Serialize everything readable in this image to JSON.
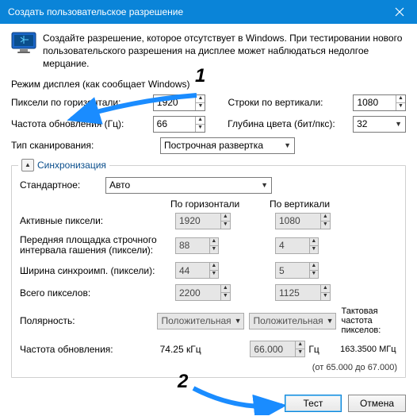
{
  "window": {
    "title": "Создать пользовательское разрешение"
  },
  "intro": "Создайте разрешение, которое отсутствует в Windows. При тестировании нового пользовательского разрешения на дисплее может наблюдаться недолгое мерцание.",
  "mode_label": "Режим дисплея (как сообщает Windows)",
  "fields": {
    "hpixels_label": "Пиксели по горизонтали:",
    "hpixels": "1920",
    "vlines_label": "Строки по вертикали:",
    "vlines": "1080",
    "refresh_label": "Частота обновления (Гц):",
    "refresh": "66",
    "depth_label": "Глубина цвета (бит/пкс):",
    "depth": "32",
    "scan_label": "Тип сканирования:",
    "scan": "Построчная развертка"
  },
  "sync": {
    "title": "Синхронизация",
    "standard_label": "Стандартное:",
    "standard": "Авто",
    "col_h": "По горизонтали",
    "col_v": "По вертикали",
    "active_label": "Активные пиксели:",
    "active_h": "1920",
    "active_v": "1080",
    "porch_label": "Передняя площадка строчного интервала гашения (пиксели):",
    "porch_h": "88",
    "porch_v": "4",
    "syncw_label": "Ширина синхроимп. (пиксели):",
    "syncw_h": "44",
    "syncw_v": "5",
    "total_label": "Всего пикселов:",
    "total_h": "2200",
    "total_v": "1125",
    "polarity_label": "Полярность:",
    "polarity_h": "Положительная",
    "polarity_v": "Положительная",
    "pixelclock_label": "Тактовая частота пикселов:",
    "pixelclock_value": "163.3500 МГц",
    "hfreq_label": "Частота обновления:",
    "hfreq_value": "74.25 кГц",
    "vfreq_value": "66.000",
    "hz": "Гц",
    "range": "(от 65.000 до 67.000)"
  },
  "buttons": {
    "test": "Тест",
    "cancel": "Отмена"
  },
  "annotations": {
    "n1": "1",
    "n2": "2"
  }
}
